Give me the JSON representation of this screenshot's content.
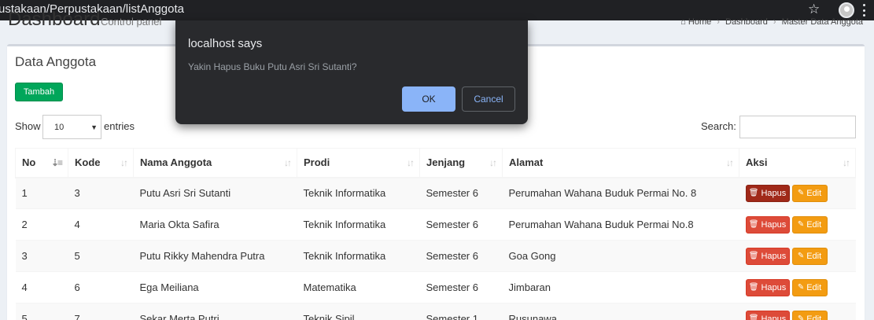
{
  "browser": {
    "url": "ustakaan/Perpustakaan/listAnggota"
  },
  "header": {
    "title": "Dashboard",
    "subtitle": "Control panel",
    "breadcrumb": [
      "Home",
      "Dashboard",
      "Master Data Anggota"
    ]
  },
  "box": {
    "title": "Data Anggota",
    "add_button": "Tambah",
    "show_label": "Show",
    "length_value": "10",
    "entries_label": "entries",
    "search_label": "Search:",
    "search_value": ""
  },
  "table": {
    "columns": [
      "No",
      "Kode",
      "Nama Anggota",
      "Prodi",
      "Jenjang",
      "Alamat",
      "Aksi"
    ],
    "delete_label": "Hapus",
    "edit_label": "Edit",
    "rows": [
      {
        "no": "1",
        "kode": "3",
        "nama": "Putu Asri Sri Sutanti",
        "prodi": "Teknik Informatika",
        "jenjang": "Semester 6",
        "alamat": "Perumahan Wahana Buduk Permai No. 8"
      },
      {
        "no": "2",
        "kode": "4",
        "nama": "Maria Okta Safira",
        "prodi": "Teknik Informatika",
        "jenjang": "Semester 6",
        "alamat": "Perumahan Wahana Buduk Permai No.8"
      },
      {
        "no": "3",
        "kode": "5",
        "nama": "Putu Rikky Mahendra Putra",
        "prodi": "Teknik Informatika",
        "jenjang": "Semester 6",
        "alamat": "Goa Gong"
      },
      {
        "no": "4",
        "kode": "6",
        "nama": "Ega Meiliana",
        "prodi": "Matematika",
        "jenjang": "Semester 6",
        "alamat": "Jimbaran"
      },
      {
        "no": "5",
        "kode": "7",
        "nama": "Sekar Merta Putri",
        "prodi": "Teknik Sipil",
        "jenjang": "Semester 1",
        "alamat": "Rusunawa"
      }
    ]
  },
  "dialog": {
    "title": "localhost says",
    "message": "Yakin Hapus Buku Putu Asri Sri Sutanti?",
    "ok_label": "OK",
    "cancel_label": "Cancel"
  },
  "colors": {
    "primary_add": "#00a65a",
    "danger": "#dd4b39",
    "warning": "#f39c12",
    "dialog_bg": "#292a2d",
    "dialog_accent": "#8ab4f8"
  }
}
